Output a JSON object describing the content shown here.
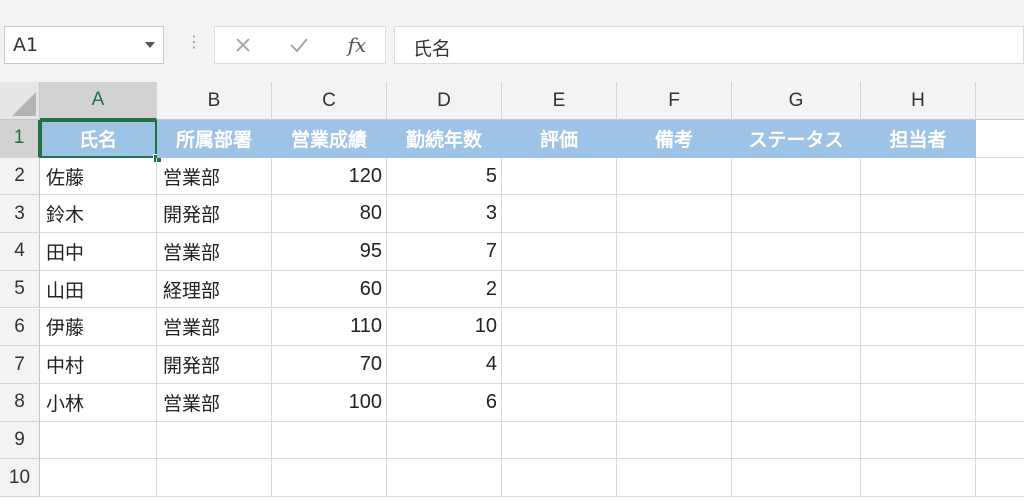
{
  "formula_bar": {
    "name_box": "A1",
    "formula": "氏名",
    "fx_label": "fx",
    "cancel_icon": "x-icon",
    "enter_icon": "check-icon"
  },
  "columns": [
    "A",
    "B",
    "C",
    "D",
    "E",
    "F",
    "G",
    "H"
  ],
  "rows": [
    "1",
    "2",
    "3",
    "4",
    "5",
    "6",
    "7",
    "8",
    "9",
    "10"
  ],
  "selection": {
    "cell": "A1",
    "col": "A",
    "row": "1"
  },
  "colors": {
    "header_fill": "#9dc3e6",
    "accent": "#217346"
  },
  "table": {
    "headers": [
      "氏名",
      "所属部署",
      "営業成績",
      "勤続年数",
      "評価",
      "備考",
      "ステータス",
      "担当者"
    ],
    "rows": [
      [
        "佐藤",
        "営業部",
        "120",
        "5"
      ],
      [
        "鈴木",
        "開発部",
        "80",
        "3"
      ],
      [
        "田中",
        "営業部",
        "95",
        "7"
      ],
      [
        "山田",
        "経理部",
        "60",
        "2"
      ],
      [
        "伊藤",
        "営業部",
        "110",
        "10"
      ],
      [
        "中村",
        "開発部",
        "70",
        "4"
      ],
      [
        "小林",
        "営業部",
        "100",
        "6"
      ]
    ]
  }
}
